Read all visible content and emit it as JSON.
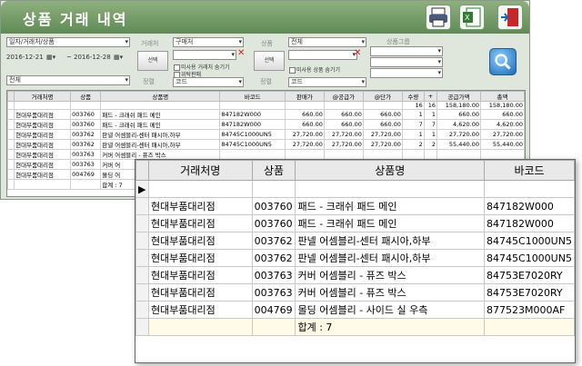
{
  "title": "상품 거래 내역",
  "filters": {
    "criteria": "일자/거래처/상품",
    "date_from": "2016-12-21",
    "date_to": "2016-12-28",
    "range_sep": "~",
    "all_label": "전체",
    "client_label": "거래처",
    "client_value": "구매처",
    "client_select": "선택",
    "client_sort_label": "정렬",
    "client_sort_value": "코드",
    "hide_unused_clients": "미사용 거래처 숨기기",
    "consign": "위탁판매",
    "product_label": "상품",
    "product_value": "전체",
    "product_select": "선택",
    "product_sort_label": "정렬",
    "product_sort_value": "코드",
    "hide_unused_products": "미사용 상품 숨기기",
    "group_label": "상품그룹"
  },
  "small_grid": {
    "headers": [
      "거래처명",
      "상품",
      "상품명",
      "바코드",
      "판매가",
      "@공급가",
      "@단가",
      "수량",
      "+",
      "공급가액",
      "총액"
    ],
    "summary": [
      "",
      "",
      "",
      "",
      "",
      "",
      "",
      "16",
      "16",
      "158,180.00",
      "158,180.00"
    ],
    "rows": [
      [
        "현대부품대리점",
        "003760",
        "패드 - 크래쉬 패드 메인",
        "847182W000",
        "660.00",
        "660.00",
        "660.00",
        "1",
        "1",
        "660.00",
        "660.00"
      ],
      [
        "현대부품대리점",
        "003760",
        "패드 - 크래쉬 패드 메인",
        "847182W000",
        "660.00",
        "660.00",
        "660.00",
        "7",
        "7",
        "4,620.00",
        "4,620.00"
      ],
      [
        "현대부품대리점",
        "003762",
        "판넬 어셈블리-센터 패시아,하부",
        "84745C1000UN5",
        "27,720.00",
        "27,720.00",
        "27,720.00",
        "1",
        "1",
        "27,720.00",
        "27,720.00"
      ],
      [
        "현대부품대리점",
        "003762",
        "판넬 어셈블리-센터 패시아,하부",
        "84745C1000UN5",
        "27,720.00",
        "27,720.00",
        "27,720.00",
        "2",
        "2",
        "55,440.00",
        "55,440.00"
      ],
      [
        "현대부품대리점",
        "003763",
        "커버 어셈블리 - 퓨즈 박스",
        "",
        "",
        "",
        "",
        "",
        "",
        "",
        ""
      ],
      [
        "현대부품대리점",
        "003763",
        "커버 어",
        "",
        "",
        "",
        "",
        "",
        "",
        "",
        ""
      ],
      [
        "현대부품대리점",
        "004769",
        "몰딩 어",
        "",
        "",
        "",
        "",
        "",
        "",
        "",
        ""
      ]
    ],
    "total": "합계 : 7"
  },
  "zoom_grid": {
    "headers": [
      "거래처명",
      "상품",
      "상품명",
      "바코드"
    ],
    "rows": [
      [
        "현대부품대리점",
        "003760",
        "패드 - 크래쉬 패드 메인",
        "847182W000"
      ],
      [
        "현대부품대리점",
        "003760",
        "패드 - 크래쉬 패드 메인",
        "847182W000"
      ],
      [
        "현대부품대리점",
        "003762",
        "판넬 어셈블리-센터 패시아,하부",
        "84745C1000UN5"
      ],
      [
        "현대부품대리점",
        "003762",
        "판넬 어셈블리-센터 패시아,하부",
        "84745C1000UN5"
      ],
      [
        "현대부품대리점",
        "003763",
        "커버 어셈블리 - 퓨즈 박스",
        "84753E7020RY"
      ],
      [
        "현대부품대리점",
        "003763",
        "커버 어셈블리 - 퓨즈 박스",
        "84753E7020RY"
      ],
      [
        "현대부품대리점",
        "004769",
        "몰딩 어셈블리 - 사이드 실 우측",
        "877523M000AF"
      ]
    ],
    "total": "합계 : 7"
  },
  "icons": {
    "print": "printer-icon",
    "excel": "excel-icon",
    "exit": "exit-door-icon",
    "search": "search-icon"
  }
}
